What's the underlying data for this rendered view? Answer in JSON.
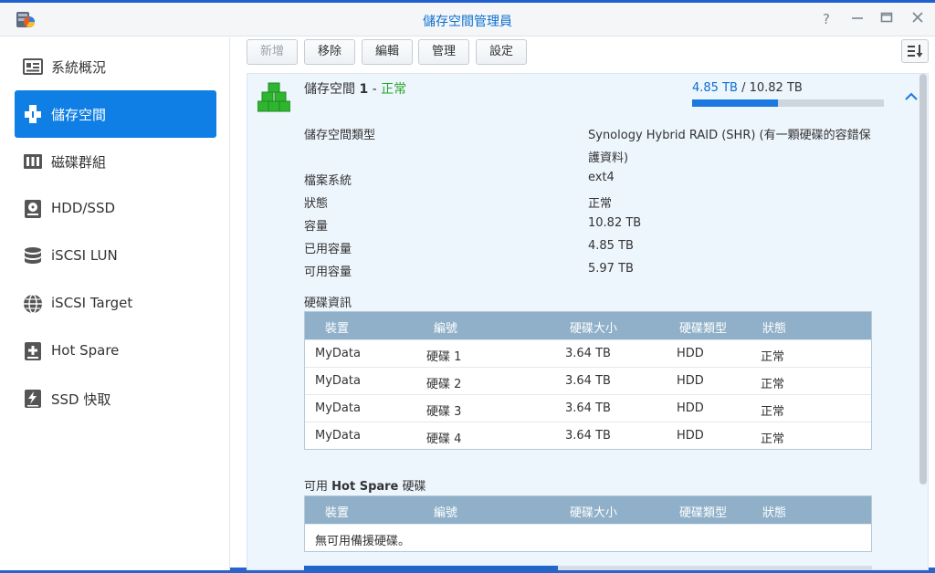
{
  "window": {
    "title": "儲存空間管理員"
  },
  "sidebar": {
    "items": [
      {
        "label": "系統概況",
        "icon": "overview-icon"
      },
      {
        "label": "儲存空間",
        "icon": "volume-icon",
        "active": true
      },
      {
        "label": "磁碟群組",
        "icon": "disk-group-icon"
      },
      {
        "label": "HDD/SSD",
        "icon": "hdd-icon"
      },
      {
        "label": "iSCSI LUN",
        "icon": "database-icon"
      },
      {
        "label": "iSCSI Target",
        "icon": "globe-icon"
      },
      {
        "label": "Hot Spare",
        "icon": "plus-box-icon"
      },
      {
        "label": "SSD 快取",
        "icon": "ssd-cache-icon"
      }
    ]
  },
  "toolbar": {
    "create": "新增",
    "remove": "移除",
    "edit": "編輯",
    "manage": "管理",
    "settings": "設定"
  },
  "volume": {
    "name": "儲存空間",
    "number": "1",
    "separator": "-",
    "status": "正常",
    "used": "4.85 TB",
    "usage_sep": "/",
    "total": "10.82 TB",
    "usage_fraction": 0.448,
    "info": [
      {
        "label": "儲存空間類型",
        "value": "Synology Hybrid RAID (SHR) (有一顆硬碟的容錯保",
        "value2": "護資料)"
      },
      {
        "label": "檔案系統",
        "value": "ext4"
      },
      {
        "label": "狀態",
        "value": "正常",
        "status": true
      },
      {
        "label": "容量",
        "value": "10.82 TB"
      },
      {
        "label": "已用容量",
        "value": "4.85 TB"
      },
      {
        "label": "可用容量",
        "value": "5.97 TB"
      }
    ]
  },
  "disk_info": {
    "title": "硬碟資訊",
    "headers": [
      "裝置",
      "編號",
      "硬碟大小",
      "硬碟類型",
      "狀態"
    ],
    "rows": [
      [
        "MyData",
        "硬碟 1",
        "3.64 TB",
        "HDD",
        "正常"
      ],
      [
        "MyData",
        "硬碟 2",
        "3.64 TB",
        "HDD",
        "正常"
      ],
      [
        "MyData",
        "硬碟 3",
        "3.64 TB",
        "HDD",
        "正常"
      ],
      [
        "MyData",
        "硬碟 4",
        "3.64 TB",
        "HDD",
        "正常"
      ]
    ]
  },
  "hot_spare": {
    "title_prefix": "可用",
    "title_bold": "Hot Spare",
    "title_suffix": "硬碟",
    "headers": [
      "裝置",
      "編號",
      "硬碟大小",
      "硬碟類型",
      "狀態"
    ],
    "empty_text": "無可用備援硬碟。"
  },
  "colors": {
    "accent": "#0f7fe5",
    "status_ok": "#2aa52a",
    "table_header": "#8fb0c8",
    "panel_bg": "#edf5fd"
  }
}
